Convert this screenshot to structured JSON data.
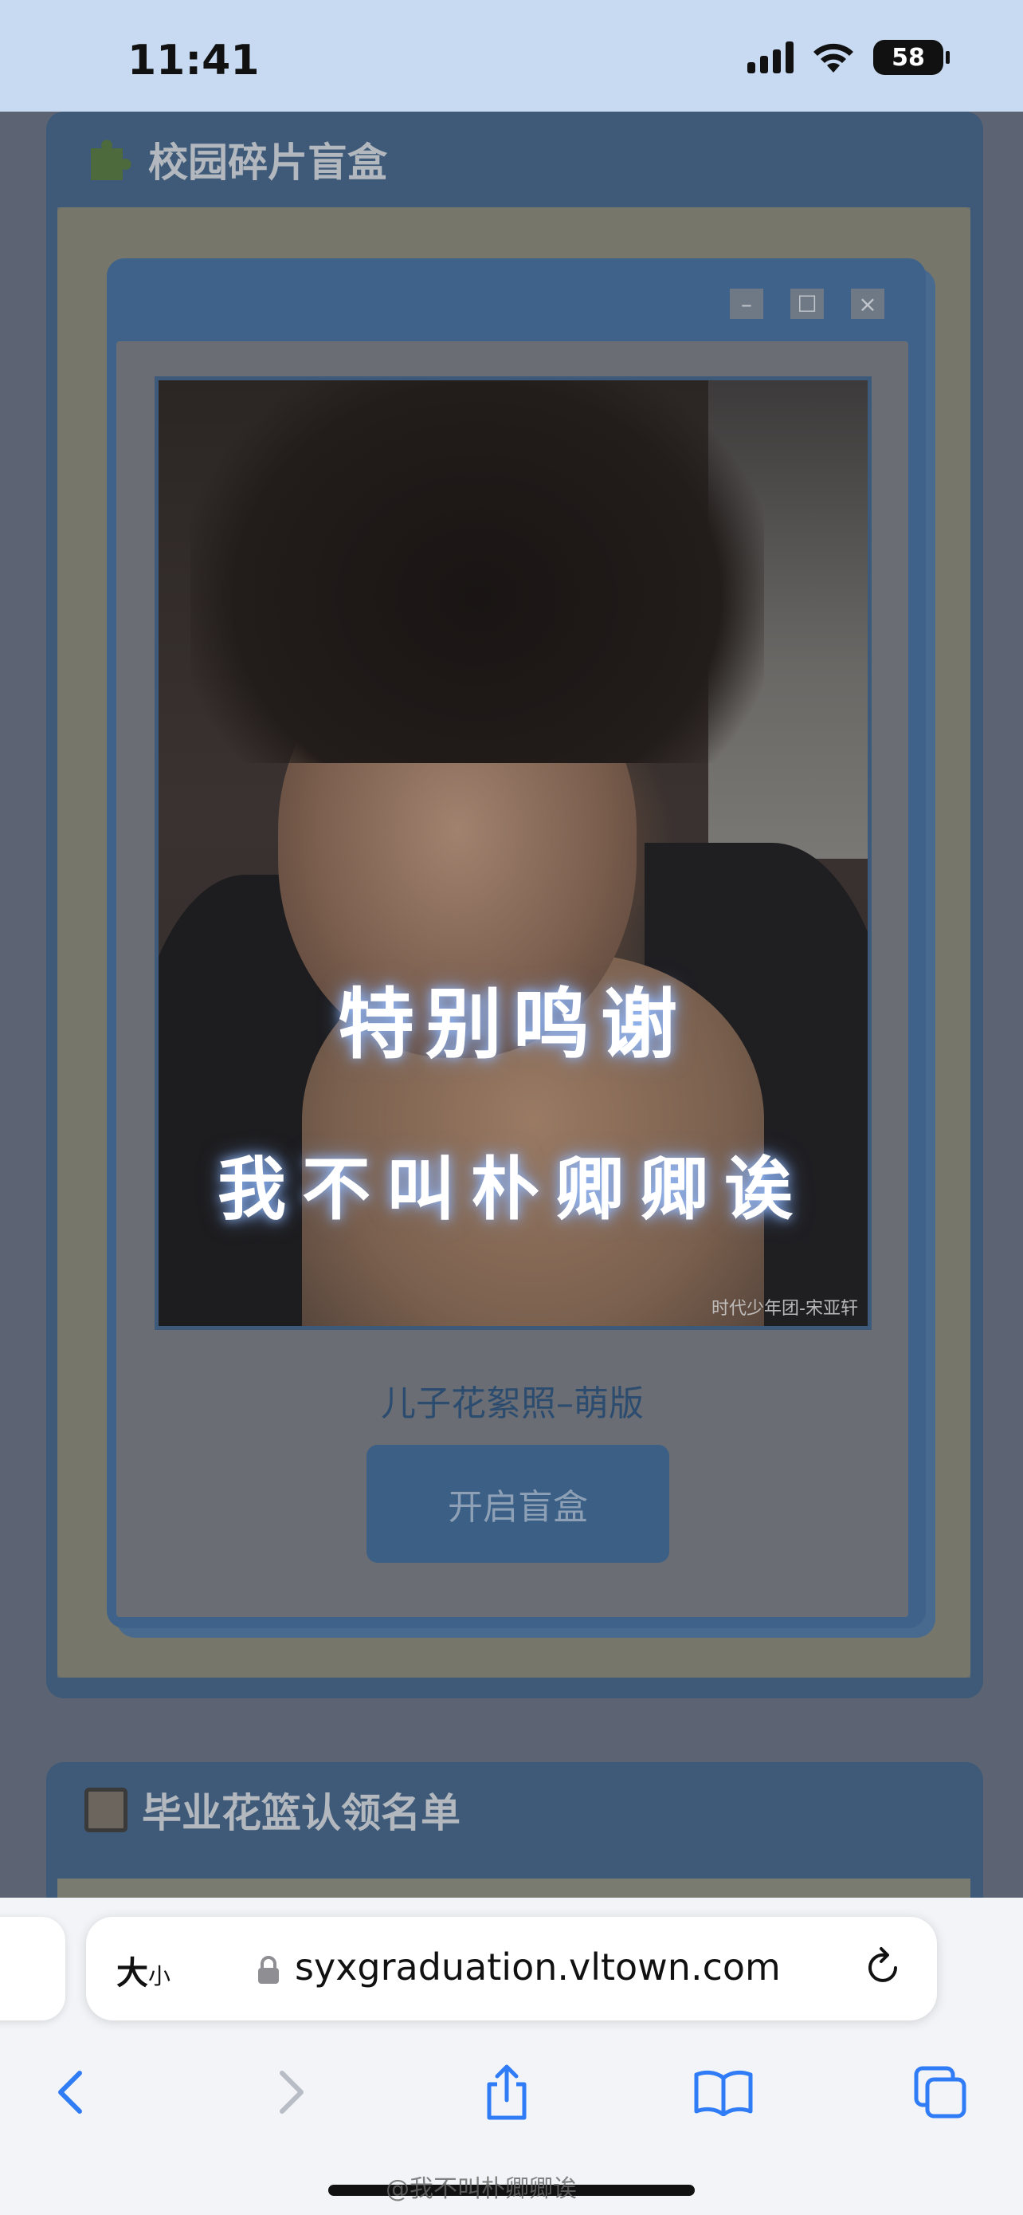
{
  "status_bar": {
    "time": "11:41",
    "battery": "58"
  },
  "section1": {
    "title": "校园碎片盲盒"
  },
  "window": {
    "controls": {
      "minimize": "–",
      "maximize": "☐",
      "close": "×"
    },
    "overlay_line1": "特别鸣谢",
    "overlay_line2": "我不叫朴卿卿诶",
    "photo_watermark": "时代少年团-宋亚轩",
    "caption": "儿子花絮照–萌版",
    "open_button": "开启盲盒"
  },
  "section2": {
    "title": "毕业花篮认领名单"
  },
  "browser": {
    "text_size_label": "大",
    "text_size_small": "小",
    "url": "syxgraduation.vltown.com"
  },
  "footer_watermark": "@我不叫朴卿卿诶",
  "colors": {
    "accent": "#3e5a78",
    "link_blue": "#2f7cf6"
  },
  "icons": [
    "puzzle-icon",
    "list-icon",
    "lock-icon",
    "reload-icon",
    "back-icon",
    "forward-icon",
    "share-icon",
    "bookmarks-icon",
    "tabs-icon"
  ]
}
